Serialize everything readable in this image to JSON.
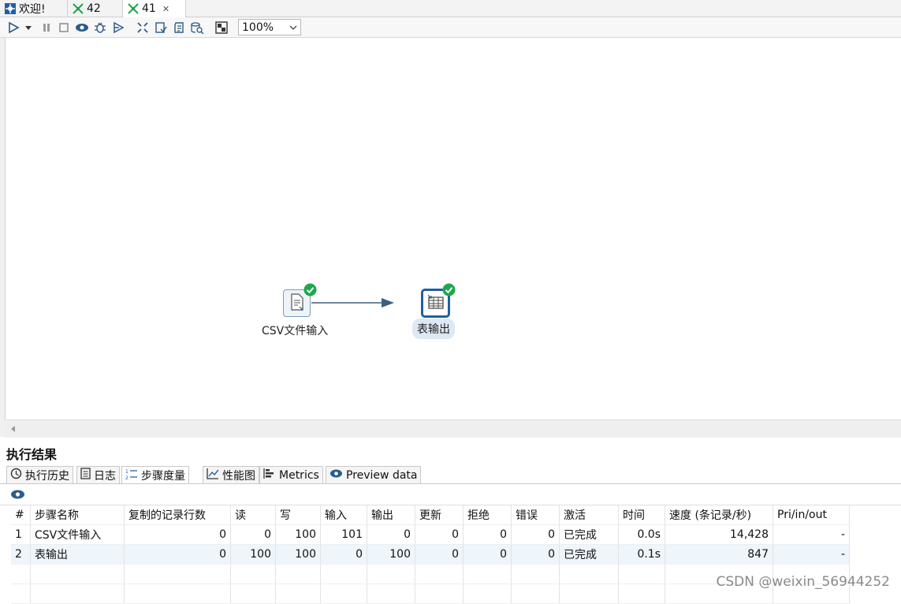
{
  "tabs": [
    {
      "label": "欢迎!",
      "icon": "welcome-icon",
      "active": false
    },
    {
      "label": "42",
      "icon": "transformation-icon",
      "active": false
    },
    {
      "label": "41",
      "icon": "transformation-icon",
      "active": true
    }
  ],
  "toolbar": {
    "zoom": "100%",
    "buttons": [
      "run-icon",
      "run-dropdown-icon",
      "pause-icon",
      "stop-icon",
      "preview-icon",
      "debug-icon",
      "replay-icon",
      "check-icon",
      "impact-icon",
      "sql-icon",
      "explore-db-icon",
      "show-results-icon"
    ]
  },
  "canvas": {
    "nodes": [
      {
        "label": "CSV文件输入",
        "icon": "csv-input-icon",
        "status": "success"
      },
      {
        "label": "表输出",
        "icon": "table-output-icon",
        "status": "success"
      }
    ]
  },
  "results": {
    "title": "执行结果",
    "tabs": [
      {
        "label": "执行历史",
        "icon": "history-icon"
      },
      {
        "label": "日志",
        "icon": "log-icon"
      },
      {
        "label": "步骤度量",
        "icon": "step-metrics-icon",
        "active": true
      },
      {
        "label": "性能图",
        "icon": "performance-icon"
      },
      {
        "label": "Metrics",
        "icon": "metrics-icon"
      },
      {
        "label": "Preview data",
        "icon": "preview-data-icon"
      }
    ],
    "columns": [
      "#",
      "步骤名称",
      "复制的记录行数",
      "读",
      "写",
      "输入",
      "输出",
      "更新",
      "拒绝",
      "错误",
      "激活",
      "时间",
      "速度 (条记录/秒)",
      "Pri/in/out"
    ],
    "rows": [
      [
        "1",
        "CSV文件输入",
        "0",
        "0",
        "100",
        "101",
        "0",
        "0",
        "0",
        "0",
        "已完成",
        "0.0s",
        "14,428",
        "-"
      ],
      [
        "2",
        "表输出",
        "0",
        "100",
        "100",
        "0",
        "100",
        "0",
        "0",
        "0",
        "已完成",
        "0.1s",
        "847",
        "-"
      ]
    ]
  },
  "watermark": "CSDN @weixin_56944252"
}
